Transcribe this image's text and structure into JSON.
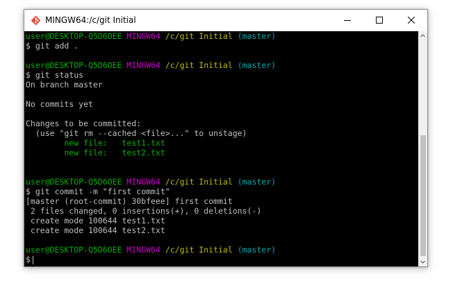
{
  "window": {
    "title": "MINGW64:/c/git Initial",
    "icon": "git-bash-icon"
  },
  "controls": {
    "minimize_icon": "minimize-icon",
    "maximize_icon": "maximize-icon",
    "close_icon": "close-icon"
  },
  "prompt": {
    "user_host": "user@DESKTOP-Q5D6OEE",
    "env": "MINGW64",
    "path": "/c/git Initial",
    "branch": "(master)",
    "symbol": "$"
  },
  "commands": {
    "add": "git add .",
    "status": "git status",
    "commit": "git commit -m \"first commit\""
  },
  "status_output": {
    "branch_line": "On branch master",
    "no_commits": "No commits yet",
    "changes_header": "Changes to be committed:",
    "hint": "  (use \"git rm --cached <file>...\" to unstage)",
    "files": [
      "        new file:   test1.txt",
      "        new file:   test2.txt"
    ]
  },
  "commit_output": [
    "[master (root-commit) 30bfeee] first commit",
    " 2 files changed, 0 insertions(+), 0 deletions(-)",
    " create mode 100644 test1.txt",
    " create mode 100644 test2.txt"
  ],
  "colors": {
    "user_host": "#00b000",
    "env": "#c700c7",
    "path": "#bdbd00",
    "branch": "#00a6b2",
    "text": "#c0c0c0",
    "background": "#000000"
  }
}
